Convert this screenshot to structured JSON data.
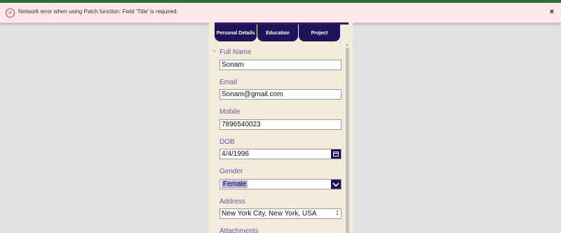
{
  "error": {
    "message": "Network error when using Patch function: Field 'Title' is required.",
    "icon": "error-circle-icon",
    "close_glyph": "×",
    "icon_glyph": "×"
  },
  "tabs": [
    {
      "label": "Personal Details"
    },
    {
      "label": "Education"
    },
    {
      "label": "Project"
    }
  ],
  "form": {
    "required_marker": "*",
    "full_name": {
      "label": "Full Name",
      "value": "Sonam"
    },
    "email": {
      "label": "Email",
      "value": "Sonam@gmail.com"
    },
    "mobile": {
      "label": "Mobile",
      "value": "7896540023"
    },
    "dob": {
      "label": "DOB",
      "value": "4/4/1996"
    },
    "gender": {
      "label": "Gender",
      "value": "Female"
    },
    "address": {
      "label": "Address",
      "value": "New York City, New York, USA"
    },
    "attachments": {
      "label": "Attachments"
    }
  },
  "colors": {
    "accent": "#1f1359",
    "label": "#6b58a8",
    "panel_bg": "#f1ecdb",
    "error_bg": "#fde7e9"
  }
}
